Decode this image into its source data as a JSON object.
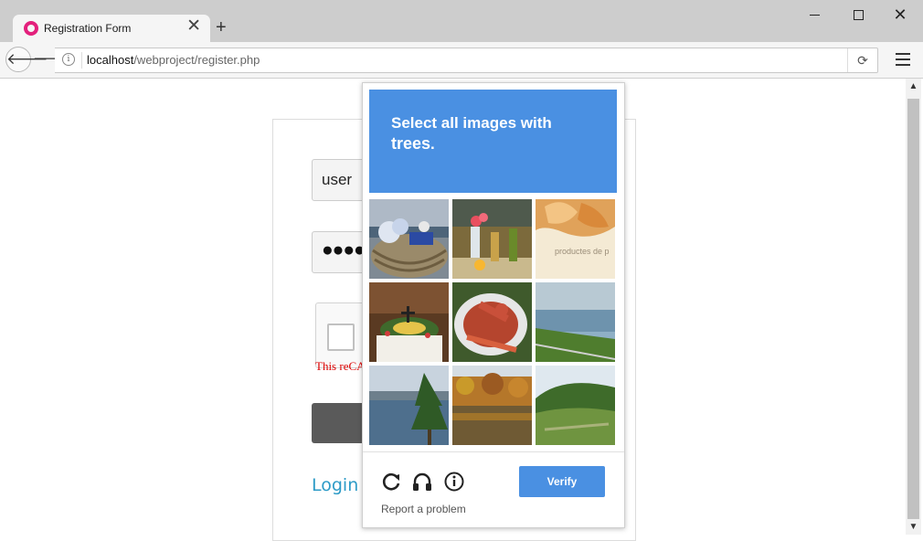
{
  "browser": {
    "tab_title": "Registration Form",
    "tab_close": "✕",
    "new_tab": "+",
    "url_host": "localhost",
    "url_path": "/webproject/register.php"
  },
  "form": {
    "username_value": "user",
    "password_mask": "●●●●",
    "recaptcha_error": "This reCA",
    "login_link": "Login"
  },
  "captcha": {
    "prompt_prefix": "Select all images with",
    "prompt_target": "trees",
    "prompt_suffix": ".",
    "tile_caption": "productes de p",
    "verify_label": "Verify",
    "report_label": "Report a problem"
  },
  "colors": {
    "accent_blue": "#4a90e2",
    "login_link": "#2d9bc7",
    "error_red": "#dd0000"
  }
}
